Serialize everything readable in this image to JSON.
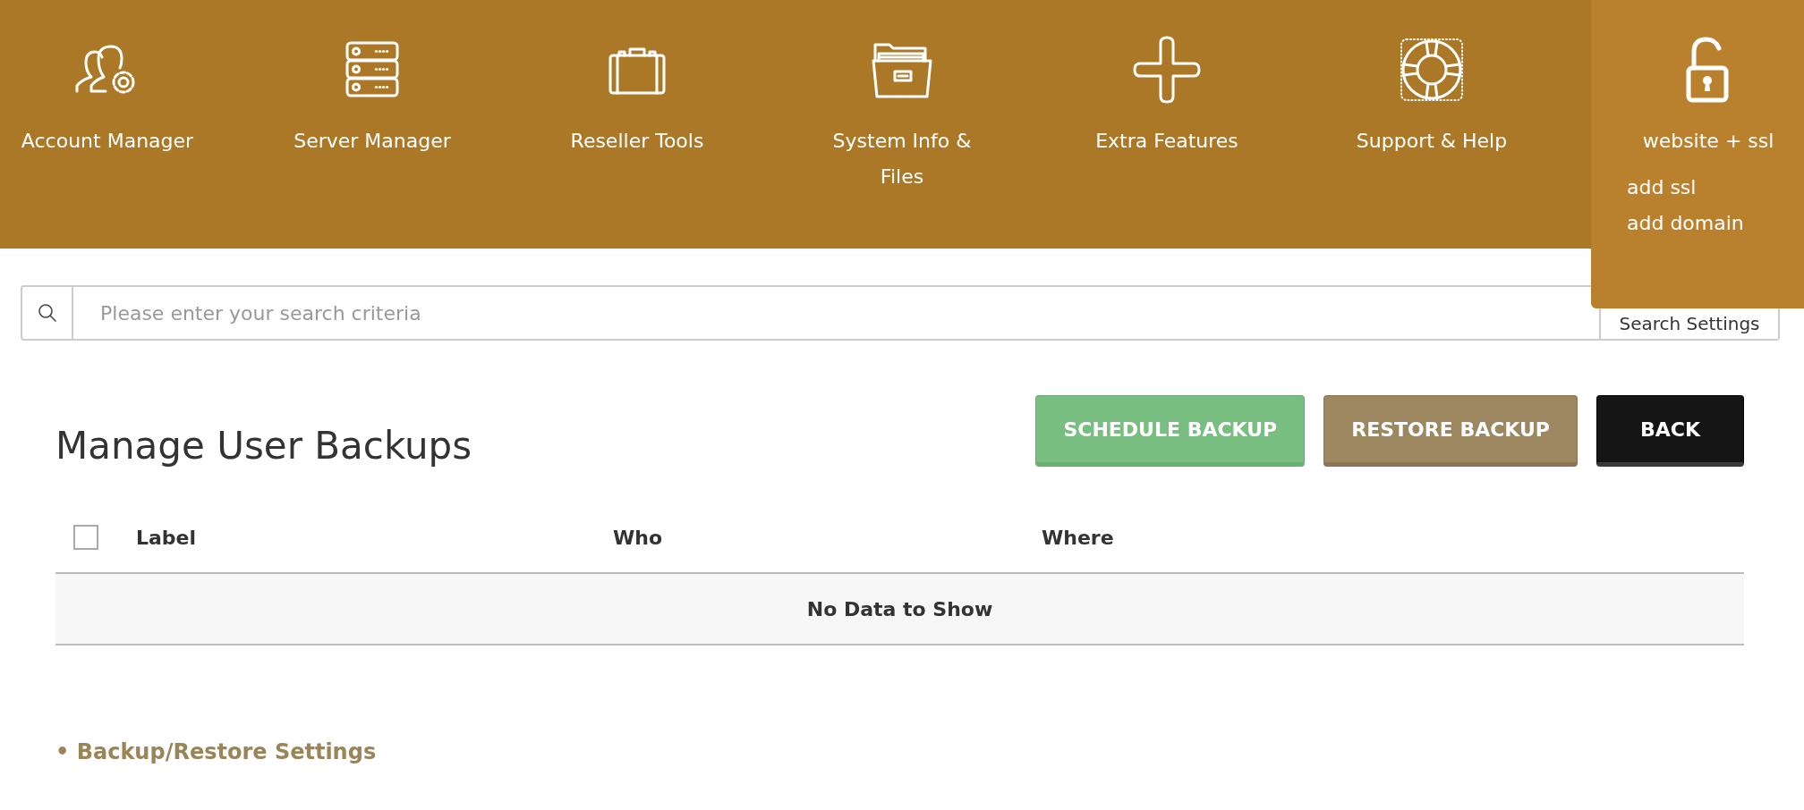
{
  "nav": {
    "items": [
      {
        "label": "Account Manager",
        "expanded": false
      },
      {
        "label": "Server Manager",
        "expanded": false
      },
      {
        "label": "Reseller Tools",
        "expanded": false
      },
      {
        "label": "System Info & Files",
        "expanded": false
      },
      {
        "label": "Extra Features",
        "expanded": false
      },
      {
        "label": "Support & Help",
        "expanded": false
      },
      {
        "label": "website + ssl",
        "expanded": true,
        "children": [
          {
            "label": "add ssl"
          },
          {
            "label": "add domain"
          }
        ]
      }
    ]
  },
  "search": {
    "placeholder": "Please enter your search criteria",
    "settings_button": "Search Settings"
  },
  "page": {
    "title": "Manage User Backups",
    "buttons": [
      {
        "label": "SCHEDULE BACKUP",
        "kind": "success"
      },
      {
        "label": "RESTORE BACKUP",
        "kind": "accent"
      },
      {
        "label": "BACK",
        "kind": "dark"
      }
    ]
  },
  "table": {
    "select_all": {
      "checked": false
    },
    "columns": [
      "Label",
      "Who",
      "Where"
    ],
    "empty_message": "No Data to Show"
  },
  "links": [
    "• Backup/Restore Settings"
  ]
}
